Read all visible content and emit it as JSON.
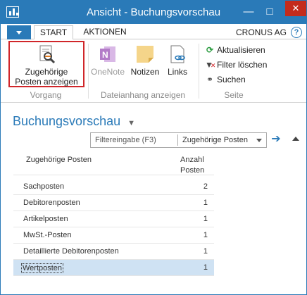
{
  "window": {
    "title": "Ansicht - Buchungsvorschau",
    "minimize": "—",
    "maximize": "□",
    "close": "✕",
    "icon": "app-grid-icon"
  },
  "tabs": [
    {
      "label": "START"
    },
    {
      "label": "AKTIONEN"
    }
  ],
  "company": "CRONUS AG",
  "help": "?",
  "ribbon": {
    "related_line1": "Zugehörige",
    "related_line2": "Posten anzeigen",
    "onenote": "OneNote",
    "notes": "Notizen",
    "links": "Links",
    "refresh": "Aktualisieren",
    "clear_filter": "Filter löschen",
    "search": "Suchen",
    "groups": {
      "vorgang": "Vorgang",
      "attachment": "Dateianhang anzeigen",
      "page": "Seite"
    }
  },
  "page": {
    "title": "Buchungsvorschau",
    "filter_label": "Filtereingabe (F3)",
    "filter_field": "Zugehörige Posten"
  },
  "table": {
    "col1": "Zugehörige Posten",
    "col2_line1": "Anzahl",
    "col2_line2": "Posten",
    "rows": [
      {
        "name": "Sachposten",
        "count": "2"
      },
      {
        "name": "Debitorenposten",
        "count": "1"
      },
      {
        "name": "Artikelposten",
        "count": "1"
      },
      {
        "name": "MwSt.-Posten",
        "count": "1"
      },
      {
        "name": "Detaillierte Debitorenposten",
        "count": "1"
      },
      {
        "name": "Wertposten",
        "count": "1"
      }
    ],
    "selected_index": 5
  },
  "colors": {
    "accent": "#2a7ab8",
    "highlight_border": "#d0262a",
    "selected_row": "#cfe2f3",
    "close": "#c42b1c"
  }
}
